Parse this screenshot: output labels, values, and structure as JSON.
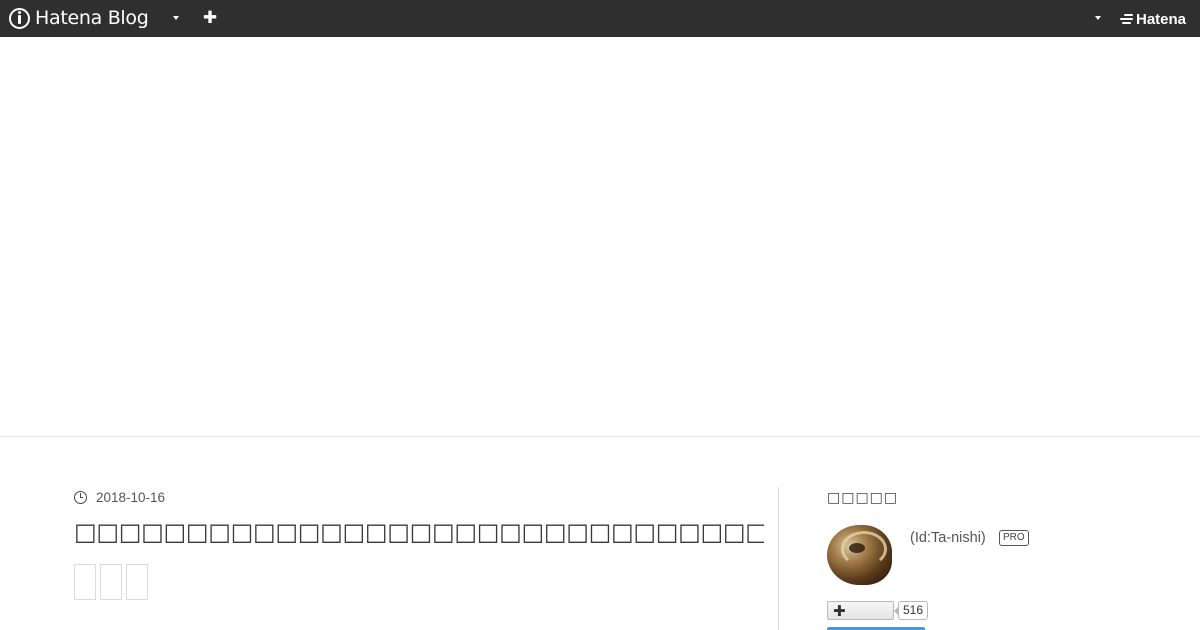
{
  "header": {
    "logo_text": "Hatena Blog",
    "brand_text": "Hatena",
    "background_color": "#2f2f2f"
  },
  "article": {
    "date": "2018-10-16",
    "title": "□□□□□□□□□□□□□□□□□□□□□□□□□□□□□□□□□□14□"
  },
  "sidebar": {
    "section_title": "□□□□□",
    "user_id": "(Id:Ta-nishi)",
    "pro_badge": "PRO",
    "follower_count": "516",
    "accent_color": "#3d9be9"
  }
}
